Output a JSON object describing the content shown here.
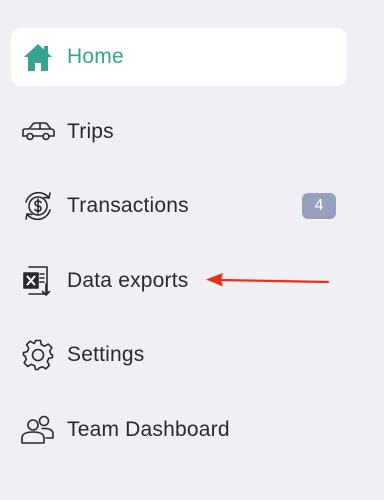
{
  "nav": {
    "items": [
      {
        "label": "Home",
        "icon": "home-icon",
        "active": true
      },
      {
        "label": "Trips",
        "icon": "car-icon"
      },
      {
        "label": "Transactions",
        "icon": "dollar-cycle-icon",
        "badge": "4"
      },
      {
        "label": "Data exports",
        "icon": "excel-export-icon"
      },
      {
        "label": "Settings",
        "icon": "gear-icon"
      },
      {
        "label": "Team Dashboard",
        "icon": "team-icon"
      }
    ]
  },
  "colors": {
    "background": "#f0eff4",
    "active_bg": "#ffffff",
    "accent": "#35a38d",
    "text": "#2a2a2e",
    "badge_bg": "#97a1bf",
    "arrow": "#e8301c"
  }
}
